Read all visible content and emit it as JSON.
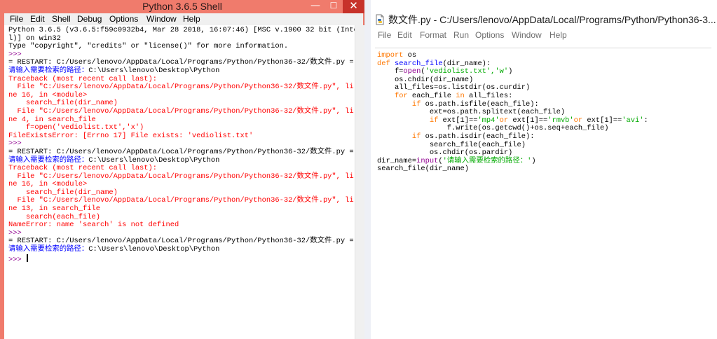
{
  "shell": {
    "title": "Python 3.6.5 Shell",
    "controls": {
      "minimize": "—",
      "maximize": "☐",
      "close": "✕"
    },
    "menu": [
      "File",
      "Edit",
      "Shell",
      "Debug",
      "Options",
      "Window",
      "Help"
    ],
    "lines": [
      [
        [
          "black",
          "Python 3.6.5 (v3.6.5:f59c0932b4, Mar 28 2018, 16:07:46) [MSC v.1900 32 bit (Inte"
        ]
      ],
      [
        [
          "black",
          "l)] on win32"
        ]
      ],
      [
        [
          "black",
          "Type \"copyright\", \"credits\" or \"license()\" for more information."
        ]
      ],
      [
        [
          "purple",
          ">>> "
        ]
      ],
      [
        [
          "black",
          "= RESTART: C:/Users/lenovo/AppData/Local/Programs/Python/Python36-32/数文件.py ="
        ]
      ],
      [
        [
          "blue",
          "请输入需要检索的路径："
        ],
        [
          "black",
          "C:\\Users\\lenovo\\Desktop\\Python"
        ]
      ],
      [
        [
          "red",
          "Traceback (most recent call last):"
        ]
      ],
      [
        [
          "red",
          "  File \"C:/Users/lenovo/AppData/Local/Programs/Python/Python36-32/数文件.py\", li"
        ]
      ],
      [
        [
          "red",
          "ne 16, in <module>"
        ]
      ],
      [
        [
          "red",
          "    search_file(dir_name)"
        ]
      ],
      [
        [
          "red",
          "  File \"C:/Users/lenovo/AppData/Local/Programs/Python/Python36-32/数文件.py\", li"
        ]
      ],
      [
        [
          "red",
          "ne 4, in search_file"
        ]
      ],
      [
        [
          "red",
          "    f=open('vediolist.txt','x')"
        ]
      ],
      [
        [
          "red",
          "FileExistsError: [Errno 17] File exists: 'vediolist.txt'"
        ]
      ],
      [
        [
          "purple",
          ">>> "
        ]
      ],
      [
        [
          "black",
          "= RESTART: C:/Users/lenovo/AppData/Local/Programs/Python/Python36-32/数文件.py ="
        ]
      ],
      [
        [
          "blue",
          "请输入需要检索的路径："
        ],
        [
          "black",
          "C:\\Users\\lenovo\\Desktop\\Python"
        ]
      ],
      [
        [
          "red",
          "Traceback (most recent call last):"
        ]
      ],
      [
        [
          "red",
          "  File \"C:/Users/lenovo/AppData/Local/Programs/Python/Python36-32/数文件.py\", li"
        ]
      ],
      [
        [
          "red",
          "ne 16, in <module>"
        ]
      ],
      [
        [
          "red",
          "    search_file(dir_name)"
        ]
      ],
      [
        [
          "red",
          "  File \"C:/Users/lenovo/AppData/Local/Programs/Python/Python36-32/数文件.py\", li"
        ]
      ],
      [
        [
          "red",
          "ne 13, in search_file"
        ]
      ],
      [
        [
          "red",
          "    search(each_file)"
        ]
      ],
      [
        [
          "red",
          "NameError: name 'search' is not defined"
        ]
      ],
      [
        [
          "purple",
          ">>> "
        ]
      ],
      [
        [
          "black",
          "= RESTART: C:/Users/lenovo/AppData/Local/Programs/Python/Python36-32/数文件.py ="
        ]
      ],
      [
        [
          "blue",
          "请输入需要检索的路径："
        ],
        [
          "black",
          "C:\\Users\\lenovo\\Desktop\\Python"
        ]
      ],
      [
        [
          "purple",
          ">>> "
        ]
      ]
    ]
  },
  "editor": {
    "title": "数文件.py - C:/Users/lenovo/AppData/Local/Programs/Python/Python36-3...",
    "menu": [
      "File",
      "Edit",
      "Format",
      "Run",
      "Options",
      "Window",
      "Help"
    ],
    "lines": [
      [
        [
          "orange",
          "import"
        ],
        [
          "black",
          " os"
        ]
      ],
      [
        [
          "orange",
          "def"
        ],
        [
          "black",
          " "
        ],
        [
          "blue",
          "search_file"
        ],
        [
          "black",
          "(dir_name):"
        ]
      ],
      [
        [
          "black",
          "    f="
        ],
        [
          "purple",
          "open"
        ],
        [
          "black",
          "("
        ],
        [
          "green",
          "'vediolist.txt','w'"
        ],
        [
          "black",
          ")"
        ]
      ],
      [
        [
          "black",
          "    os.chdir(dir_name)"
        ]
      ],
      [
        [
          "black",
          "    all_files=os.listdir(os.curdir)"
        ]
      ],
      [
        [
          "black",
          "    "
        ],
        [
          "orange",
          "for"
        ],
        [
          "black",
          " each_file "
        ],
        [
          "orange",
          "in"
        ],
        [
          "black",
          " all_files:"
        ]
      ],
      [
        [
          "black",
          "        "
        ],
        [
          "orange",
          "if"
        ],
        [
          "black",
          " os.path.isfile(each_file):"
        ]
      ],
      [
        [
          "black",
          "            ext=os.path.splitext(each_file)"
        ]
      ],
      [
        [
          "black",
          "            "
        ],
        [
          "orange",
          "if"
        ],
        [
          "black",
          " ext[1]=="
        ],
        [
          "green",
          "'mp4'"
        ],
        [
          "orange",
          "or"
        ],
        [
          "black",
          " ext[1]=="
        ],
        [
          "green",
          "'rmvb'"
        ],
        [
          "orange",
          "or"
        ],
        [
          "black",
          " ext[1]=="
        ],
        [
          "green",
          "'avi'"
        ],
        [
          "black",
          ":"
        ]
      ],
      [
        [
          "black",
          "                f.write(os.getcwd()+os.seq+each_file)"
        ]
      ],
      [
        [
          "black",
          "        "
        ],
        [
          "orange",
          "if"
        ],
        [
          "black",
          " os.path.isdir(each_file):"
        ]
      ],
      [
        [
          "black",
          "            search_file(each_file)"
        ]
      ],
      [
        [
          "black",
          "            os.chdir(os.pardir)"
        ]
      ],
      [
        [
          "black",
          "dir_name="
        ],
        [
          "purple",
          "input"
        ],
        [
          "black",
          "("
        ],
        [
          "green",
          "'请输入需要检索的路径：'"
        ],
        [
          "black",
          ")"
        ]
      ],
      [
        [
          "black",
          "search_file(dir_name)"
        ]
      ]
    ]
  }
}
